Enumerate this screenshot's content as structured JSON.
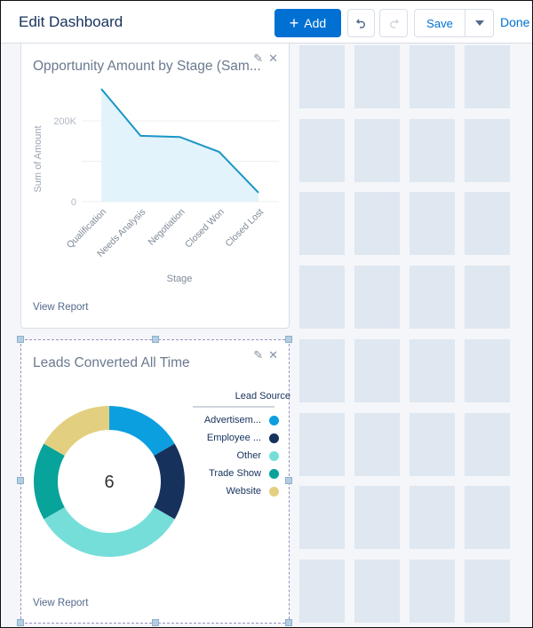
{
  "header": {
    "title": "Edit Dashboard",
    "add_label": "Add",
    "save_label": "Save",
    "done_label": "Done"
  },
  "widgets": [
    {
      "title": "Opportunity Amount by Stage (Sam...",
      "view_report": "View Report"
    },
    {
      "title": "Leads Converted All Time",
      "view_report": "View Report"
    }
  ],
  "chart_data": [
    {
      "type": "area",
      "title": "Opportunity Amount by Stage (Sam...",
      "xlabel": "Stage",
      "ylabel": "Sum of Amount",
      "categories": [
        "Qualification",
        "Needs Analysis",
        "Negotiation",
        "Closed Won",
        "Closed Lost"
      ],
      "values": [
        279000,
        163000,
        160000,
        123000,
        22000
      ],
      "yticks": [
        0,
        200000
      ],
      "ytick_labels": [
        "0",
        "200K"
      ],
      "ylim": [
        0,
        280000
      ],
      "grid": true,
      "color": "#1b96c5",
      "fill": "#e3f3fb"
    },
    {
      "type": "pie",
      "variant": "donut",
      "title": "Leads Converted All Time",
      "center_label": "6",
      "legend_title": "Lead Source",
      "legend_position": "right",
      "categories": [
        "Advertisem...",
        "Employee ...",
        "Other",
        "Trade Show",
        "Website"
      ],
      "values": [
        1,
        1,
        2,
        1,
        1
      ],
      "colors": [
        "#0b9fe0",
        "#16325c",
        "#76ded9",
        "#08a39a",
        "#e3cf80"
      ]
    }
  ]
}
